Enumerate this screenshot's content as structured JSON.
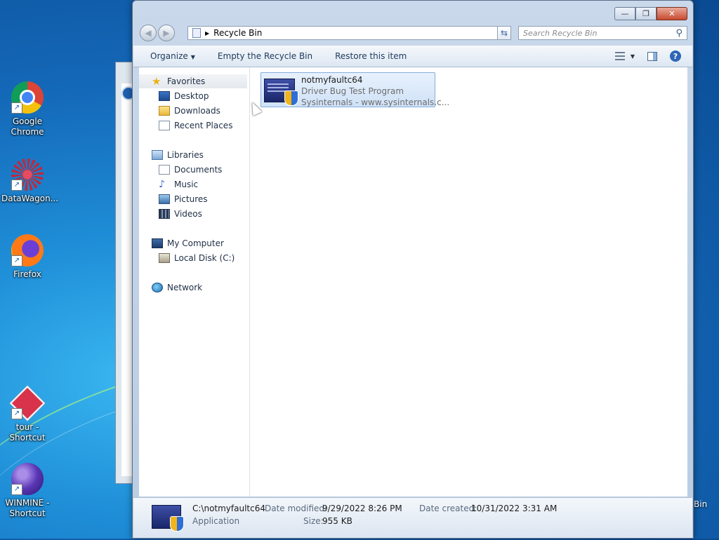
{
  "desktop": {
    "icons": [
      {
        "label": "Google Chrome",
        "icon": "chrome-icon"
      },
      {
        "label": "DataWagon...",
        "icon": "datawagon-icon"
      },
      {
        "label": "Firefox",
        "icon": "firefox-icon"
      },
      {
        "label": "tour - Shortcut",
        "icon": "tour-icon"
      },
      {
        "label": "WINMINE - Shortcut",
        "icon": "winmine-icon"
      }
    ],
    "partial_label": "Bin"
  },
  "window": {
    "address": "Recycle Bin",
    "search_placeholder": "Search Recycle Bin",
    "caption": {
      "minimize": "—",
      "maximize": "❐",
      "close": "✕"
    }
  },
  "toolbar": {
    "organize": "Organize",
    "empty": "Empty the Recycle Bin",
    "restore": "Restore this item"
  },
  "nav": {
    "favorites": "Favorites",
    "desktop": "Desktop",
    "downloads": "Downloads",
    "recent": "Recent Places",
    "libraries": "Libraries",
    "documents": "Documents",
    "music": "Music",
    "pictures": "Pictures",
    "videos": "Videos",
    "computer": "My Computer",
    "local_disk": "Local Disk (C:)",
    "network": "Network"
  },
  "file": {
    "name": "notmyfaultc64",
    "description": "Driver Bug Test Program",
    "company": "Sysinternals - www.sysinternals.c..."
  },
  "details": {
    "path": "C:\\notmyfaultc64",
    "type": "Application",
    "modified_label": "Date modified:",
    "modified_value": "9/29/2022 8:26 PM",
    "created_label": "Date created:",
    "created_value": "10/31/2022 3:31 AM",
    "size_label": "Size:",
    "size_value": "955 KB"
  }
}
